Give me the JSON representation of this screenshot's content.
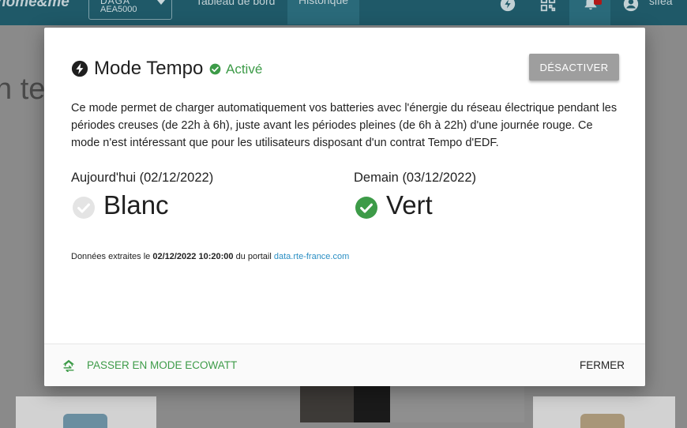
{
  "app": {
    "logo_text": "home&me",
    "device": {
      "name": "DAGA",
      "id": "AEA5000"
    },
    "nav": {
      "dashboard": "Tableau de bord",
      "history": "Historique"
    },
    "user_name": "sifea",
    "background_heading": "n ter"
  },
  "modal": {
    "title": "Mode Tempo",
    "status_label": "Activé",
    "deactivate_label": "DÉSACTIVER",
    "description": "Ce mode permet de charger automatiquement vos batteries avec l'énergie du réseau électrique pendant les périodes creuses (de 22h à 6h), juste avant les périodes pleines (de 6h à 22h) d'une journée rouge. Ce mode n'est intéressant que pour les utilisateurs disposant d'un contrat Tempo d'EDF.",
    "today": {
      "heading": "Aujourd'hui (02/12/2022)",
      "color": "Blanc",
      "icon": "check-circle-icon-grey"
    },
    "tomorrow": {
      "heading": "Demain (03/12/2022)",
      "color": "Vert",
      "icon": "check-circle-icon-green"
    },
    "source": {
      "prefix": "Données extraites le",
      "datetime": "02/12/2022 10:20:00",
      "middle": "du portail",
      "link_text": "data.rte-france.com"
    },
    "footer": {
      "ecowatt_label": "PASSER EN MODE ECOWATT",
      "close_label": "FERMER"
    }
  },
  "colors": {
    "accent_green": "#3d9b48",
    "link_blue": "#2b8fc4",
    "topbar": "#1f5968",
    "deactivate_bg": "#9e9e9e",
    "grey_check": "#e0e0e0"
  }
}
